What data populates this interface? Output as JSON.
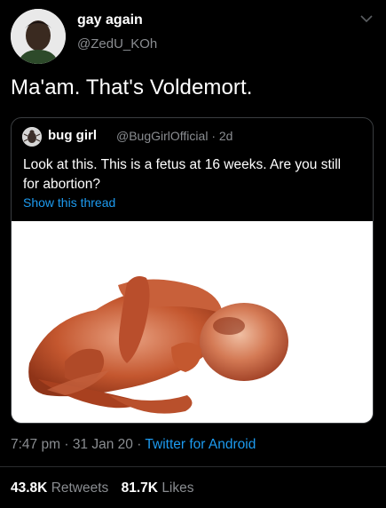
{
  "author": {
    "display_name": "gay again",
    "handle": "@ZedU_KOh"
  },
  "tweet": {
    "text": "Ma'am. That's Voldemort."
  },
  "quoted": {
    "display_name": "bug girl",
    "handle": "@BugGirlOfficial",
    "separator": "·",
    "age": "2d",
    "text": "Look at this. This is a fetus at 16 weeks. Are you still for abortion?",
    "show_thread": "Show this thread"
  },
  "meta": {
    "time": "7:47 pm",
    "sep1": "·",
    "date": "31 Jan 20",
    "sep2": "·",
    "client": "Twitter for Android"
  },
  "stats": {
    "retweets_count": "43.8K",
    "retweets_label": "Retweets",
    "likes_count": "81.7K",
    "likes_label": "Likes"
  },
  "colors": {
    "background": "#000000",
    "secondary_text": "#8a8d91",
    "link": "#1d9bf0"
  }
}
